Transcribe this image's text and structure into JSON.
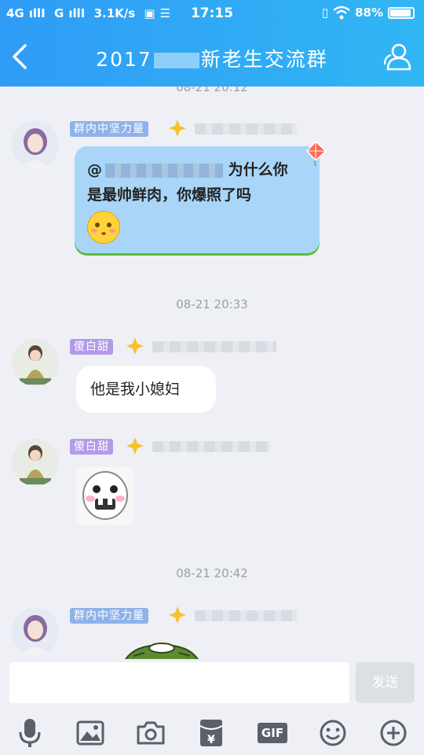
{
  "status_bar": {
    "network1": "4G",
    "network2": "G",
    "speed": "3.1K/s",
    "time": "17:15",
    "battery": "88%"
  },
  "header": {
    "title_prefix": "2017",
    "title_suffix": "新老生交流群"
  },
  "messages": [
    {
      "tag": "群内中坚力量",
      "text_at": "@",
      "text_line1": "为什么你",
      "text_line2": "是最帅鲜肉，你爆照了吗"
    },
    {
      "timestamp": "08-21 20:33",
      "tag": "傻白甜",
      "text": "他是我小媳妇"
    },
    {
      "tag": "傻白甜"
    },
    {
      "timestamp": "08-21 20:42",
      "tag": "群内中坚力量"
    }
  ],
  "input": {
    "send_label": "发送"
  },
  "toolbar": {
    "gif_label": "GIF"
  },
  "colors": {
    "accent": "#31a8f5",
    "tag_blue": "#8fb3e8",
    "tag_purple": "#b49be8"
  }
}
